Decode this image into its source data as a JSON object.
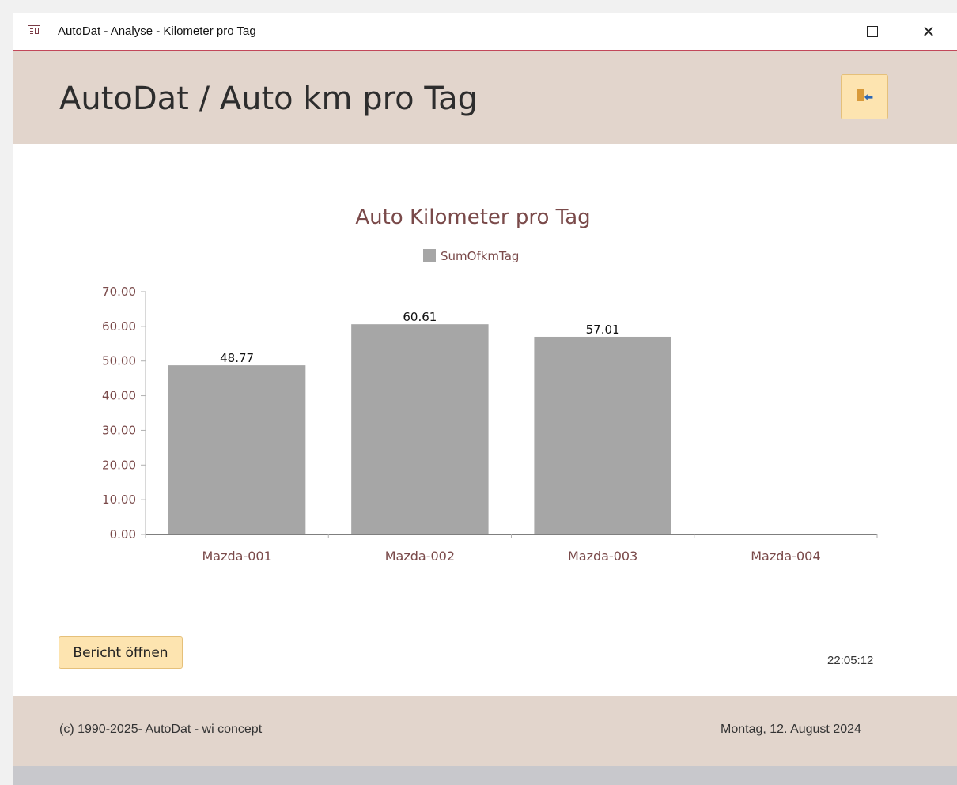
{
  "window": {
    "title": "AutoDat - Analyse - Kilometer pro Tag",
    "controls": {
      "minimize": "—",
      "maximize": "☐",
      "close": "✕"
    }
  },
  "header": {
    "title": "AutoDat / Auto km pro Tag",
    "exit_icon": "exit-door-icon"
  },
  "chart_data": {
    "type": "bar",
    "title": "Auto Kilometer pro Tag",
    "categories": [
      "Mazda-001",
      "Mazda-002",
      "Mazda-003",
      "Mazda-004"
    ],
    "series": [
      {
        "name": "SumOfkmTag",
        "values": [
          48.77,
          60.61,
          57.01,
          null
        ],
        "color": "#a6a6a6"
      }
    ],
    "data_labels": [
      "48.77",
      "60.61",
      "57.01",
      ""
    ],
    "ylim": [
      0,
      70
    ],
    "yticks": [
      "0.00",
      "10.00",
      "20.00",
      "30.00",
      "40.00",
      "50.00",
      "60.00",
      "70.00"
    ],
    "legend_position": "top",
    "grid": false
  },
  "actions": {
    "open_report": "Bericht öffnen"
  },
  "status": {
    "time": "22:05:12"
  },
  "footer": {
    "copyright": "(c) 1990-2025- AutoDat - wi concept",
    "date": "Montag, 12. August 2024"
  },
  "colors": {
    "accent": "#c2485a",
    "header_bg": "#e2d5cc",
    "button_bg": "#fde4b0",
    "bar": "#a6a6a6",
    "label_text": "#7a4a4a"
  }
}
